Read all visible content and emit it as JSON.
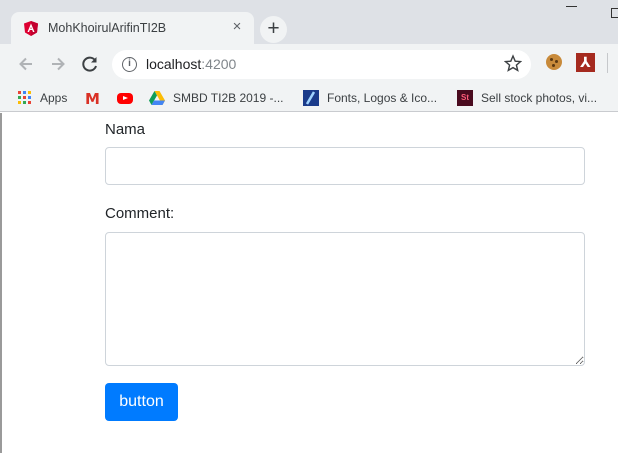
{
  "browser": {
    "tab_title": "MohKhoirulArifinTI2B",
    "tab_close_glyph": "×",
    "new_tab_glyph": "+",
    "url_host": "localhost",
    "url_port": ":4200"
  },
  "bookmarks": [
    {
      "label": "Apps",
      "icon": "apps-grid-icon"
    },
    {
      "label": "",
      "icon": "gmail-icon"
    },
    {
      "label": "",
      "icon": "youtube-icon"
    },
    {
      "label": "SMBD TI2B 2019 -...",
      "icon": "google-drive-icon"
    },
    {
      "label": "Fonts, Logos & Ico...",
      "icon": "fonts-icon"
    },
    {
      "label": "Sell stock photos, vi...",
      "icon": "adobe-stock-icon"
    }
  ],
  "form": {
    "nama_label": "Nama",
    "nama_value": "",
    "comment_label": "Comment:",
    "comment_value": "",
    "submit_label": "button"
  },
  "colors": {
    "primary_button": "#007bff",
    "angular_red": "#dd0031",
    "tabstrip": "#dee1e6",
    "toolbar": "#f1f3f4"
  }
}
